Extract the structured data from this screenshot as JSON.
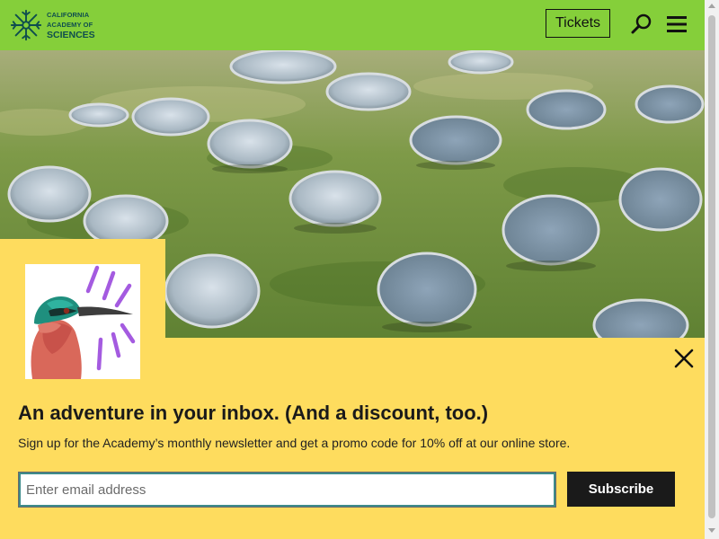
{
  "header": {
    "logo": {
      "line1": "CALIFORNIA",
      "line2": "ACADEMY OF",
      "line3": "SCIENCES"
    },
    "tickets_label": "Tickets",
    "icons": {
      "search": "search-icon",
      "menu": "hamburger-menu-icon"
    },
    "bg_color": "#85cf3a"
  },
  "hero": {
    "image": "living-roof-skylights-photo"
  },
  "newsletter": {
    "headline": "An adventure in your inbox. (And a discount, too.)",
    "subtext": "Sign up for the Academy’s monthly newsletter and get a promo code for 10% off at our online store.",
    "email_placeholder": "Enter email address",
    "subscribe_label": "Subscribe",
    "close_icon": "close-icon",
    "bird_image": "bird-illustration",
    "bg_color": "#fedc5e"
  }
}
